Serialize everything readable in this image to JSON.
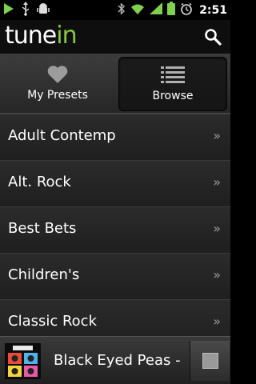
{
  "status_bar": {
    "time": "2:51",
    "icons_left": [
      "play-icon",
      "usb-icon",
      "android-debug-icon"
    ],
    "icons_right": [
      "bluetooth-icon",
      "wifi-icon",
      "signal-icon",
      "battery-icon",
      "alarm-icon"
    ]
  },
  "app": {
    "logo_part1": "tune",
    "logo_part2": "in",
    "brand_color": "#8cc63f"
  },
  "tabs": [
    {
      "label": "My Presets",
      "icon": "heart-icon",
      "selected": false
    },
    {
      "label": "Browse",
      "icon": "list-icon",
      "selected": true
    }
  ],
  "list": {
    "items": [
      {
        "label": "Adult Contemp",
        "chevron": "»"
      },
      {
        "label": "Alt. Rock",
        "chevron": "»"
      },
      {
        "label": "Best Bets",
        "chevron": "»"
      },
      {
        "label": "Children's",
        "chevron": "»"
      },
      {
        "label": "Classic Rock",
        "chevron": "»"
      }
    ]
  },
  "now_playing": {
    "title": "Black Eyed Peas -",
    "art_icon": "album-art-icon",
    "control_icon": "stop-icon"
  }
}
